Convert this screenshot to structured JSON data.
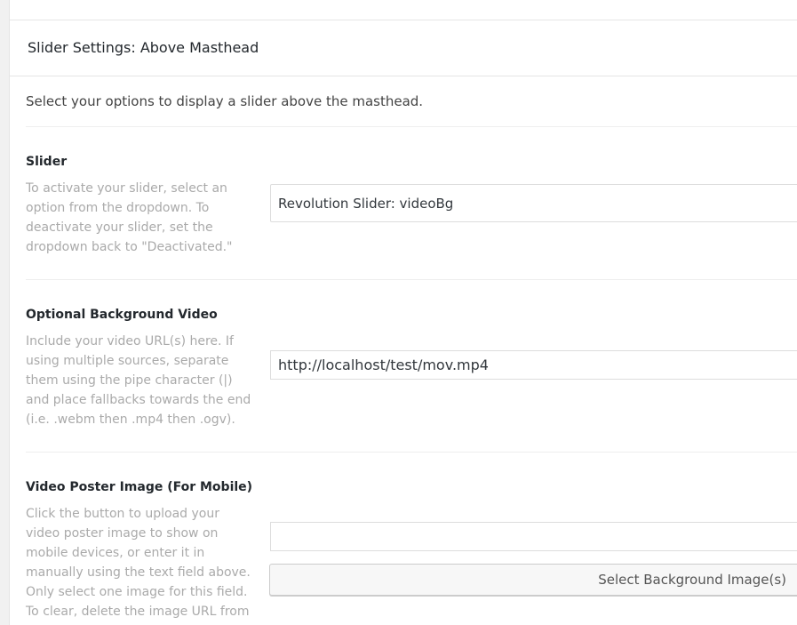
{
  "section": {
    "title": "Slider Settings: Above Masthead",
    "description": "Select your options to display a slider above the masthead."
  },
  "fields": {
    "slider": {
      "label": "Slider",
      "help": "To activate your slider, select an option from the dropdown. To deactivate your slider, set the dropdown back to \"Deactivated.\"",
      "selected": "Revolution Slider: videoBg"
    },
    "background_video": {
      "label": "Optional Background Video",
      "help": "Include your video URL(s) here. If using multiple sources, separate them using the pipe character (|) and place fallbacks towards the end (i.e. .webm then .mp4 then .ogv).",
      "value": "http://localhost/test/mov.mp4"
    },
    "poster_image": {
      "label": "Video Poster Image (For Mobile)",
      "help": "Click the button to upload your video poster image to show on mobile devices, or enter it in manually using the text field above. Only select one image for this field. To clear, delete the image URL from the text field and",
      "value": "",
      "button_label": "Select Background Image(s)"
    }
  }
}
